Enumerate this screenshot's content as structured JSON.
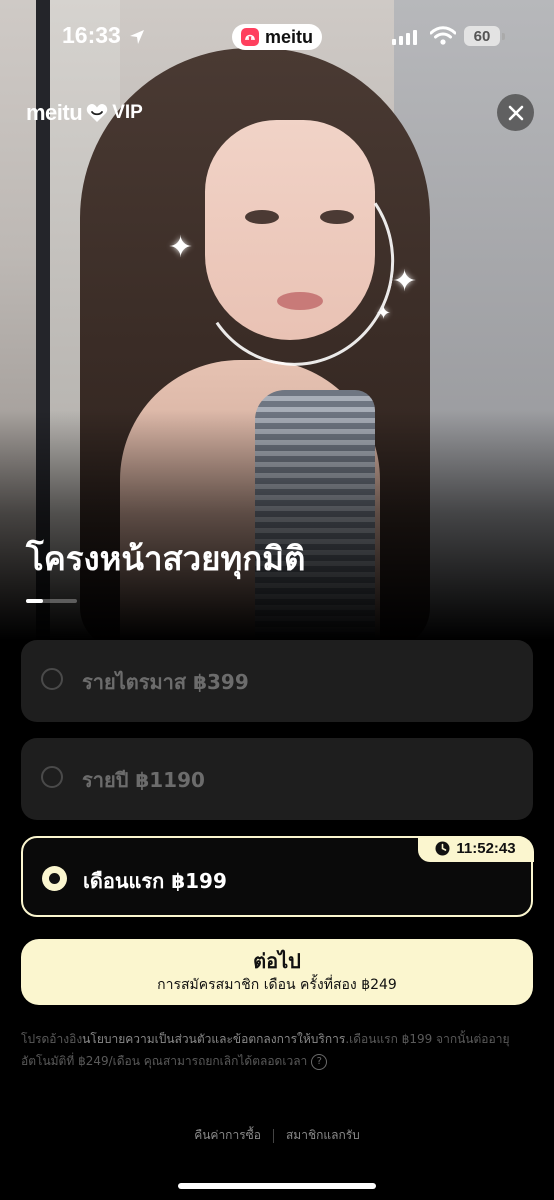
{
  "status_bar": {
    "time": "16:33",
    "app_pill": "meitu",
    "battery": "60"
  },
  "brand": {
    "name": "meitu",
    "vip": "VIP"
  },
  "hero": {
    "headline": "โครงหน้าสวยทุกมิติ",
    "pager_progress": 0.33
  },
  "plans": [
    {
      "label": "รายไตรมาส ฿399",
      "selected": false
    },
    {
      "label": "รายปี ฿1190",
      "selected": false
    },
    {
      "label": "เดือนแรก ฿199",
      "selected": true,
      "countdown": "11:52:43"
    }
  ],
  "cta": {
    "title": "ต่อไป",
    "subtitle": "การสมัครสมาชิก เดือน ครั้งที่สอง ฿249"
  },
  "legal": {
    "prefix": "โปรดอ้างอิง",
    "link": "นโยบายความเป็นส่วนตัวและข้อตกลงการให้บริการ",
    "suffix": ".เดือนแรก ฿199 จากนั้นต่ออายุอัตโนมัติที่ ฿249/เดือน คุณสามารถยกเลิกได้ตลอดเวลา"
  },
  "footer": {
    "restore": "คืนค่าการซื้อ",
    "redeem": "สมาชิกแลกรับ"
  },
  "colors": {
    "accent": "#fbf6cf",
    "card_bg": "#1e1e1e",
    "background": "#000000"
  }
}
